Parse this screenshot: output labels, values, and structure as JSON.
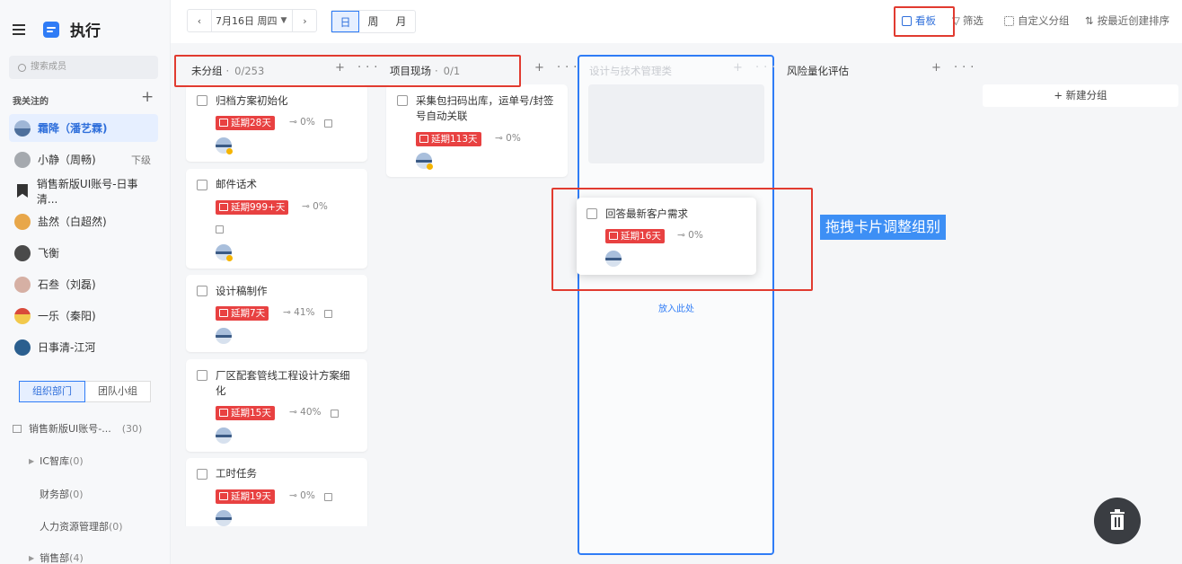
{
  "sidebar": {
    "app_title": "执行",
    "search_placeholder": "搜索成员",
    "followed_title": "我关注的",
    "members": [
      {
        "name": "霜降（潘艺霖)",
        "avatar_color": "#6d8fb8"
      },
      {
        "name": "小静（周畅)",
        "tag": "下级",
        "avatar_color": "#9aa0a8"
      },
      {
        "name": "销售新版UI账号-日事清...",
        "avatar_color": "#333333"
      },
      {
        "name": "盐然（白超然)",
        "avatar_color": "#e8a74a"
      },
      {
        "name": "飞衡",
        "avatar_color": "#4a4a4a"
      },
      {
        "name": "石叁（刘磊)",
        "avatar_color": "#c99a8a"
      },
      {
        "name": "一乐（秦阳)",
        "avatar_color": "#d94a3a"
      },
      {
        "name": "日事清-江河",
        "avatar_color": "#2b5f8f"
      }
    ],
    "tabs": [
      "组织部门",
      "团队小组"
    ],
    "tree": [
      {
        "label": "销售新版UI账号-...",
        "count": "(30)"
      },
      {
        "label": "IC智库",
        "count": "(0)"
      },
      {
        "label": "财务部",
        "count": "(0)"
      },
      {
        "label": "人力资源管理部",
        "count": "(0)"
      },
      {
        "label": "销售部",
        "count": "(4)"
      }
    ]
  },
  "toolbar": {
    "date": "7月16日 周四",
    "views": [
      "日",
      "周",
      "月"
    ],
    "actions": [
      "看板",
      "筛选",
      "自定义分组",
      "按最近创建排序"
    ]
  },
  "board": {
    "columns": [
      {
        "title": "未分组",
        "count": "0/253"
      },
      {
        "title": "项目现场",
        "count": "0/1"
      },
      {
        "title": "设计与技术管理类",
        "count": ""
      },
      {
        "title": "风险量化评估",
        "count": ""
      }
    ],
    "col1_cards": [
      {
        "title": "归档方案初始化",
        "due": "延期28天",
        "progress": "0%"
      },
      {
        "title": "邮件话术",
        "due": "延期999+天",
        "progress": "0%"
      },
      {
        "title": "设计稿制作",
        "due": "延期7天",
        "progress": "41%"
      },
      {
        "title": "厂区配套管线工程设计方案细化",
        "due": "延期15天",
        "progress": "40%"
      },
      {
        "title": "工时任务",
        "due": "延期19天",
        "progress": "0%"
      }
    ],
    "col2_cards": [
      {
        "title": "采集包扫码出库，运单号/封签号自动关联",
        "due": "延期113天",
        "progress": "0%"
      }
    ],
    "dragging_card": {
      "title": "回答最新客户需求",
      "due": "延期16天",
      "progress": "0%"
    },
    "drop_hint": "放入此处",
    "new_group": "+ 新建分组"
  },
  "annotation": {
    "callout": "拖拽卡片调整组别"
  },
  "colors": {
    "accent": "#2f7cf6",
    "overdue": "#e84141",
    "annotation_red": "#e13b30"
  }
}
